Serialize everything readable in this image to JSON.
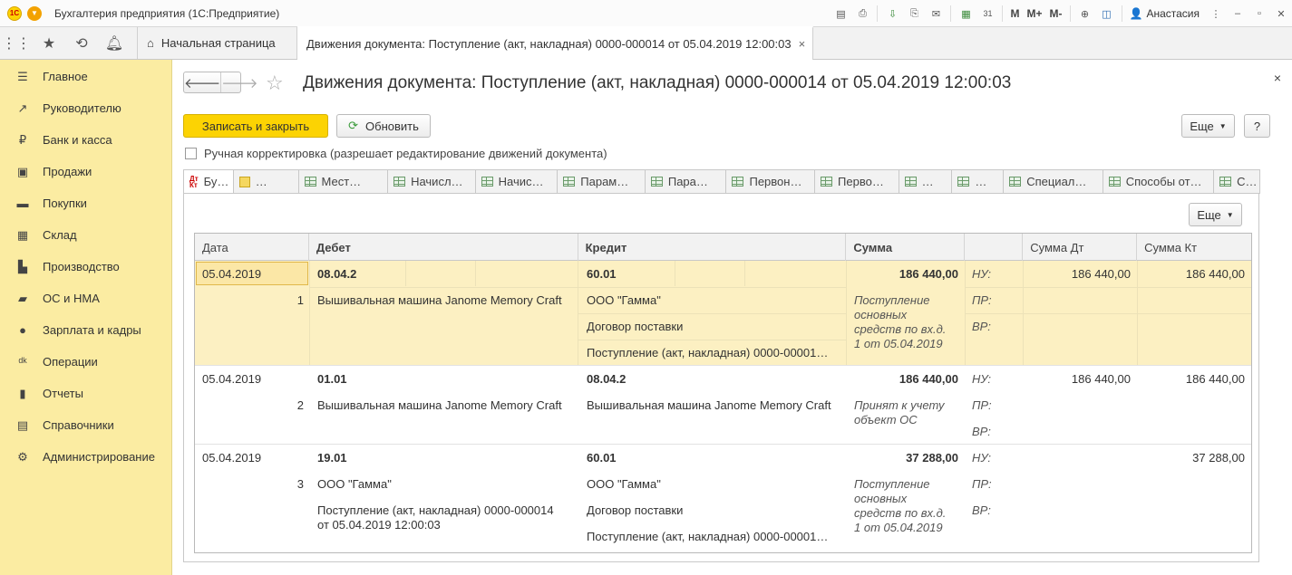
{
  "app": {
    "title": "Бухгалтерия предприятия  (1С:Предприятие)",
    "user": "Анастасия",
    "toolbar_m": [
      "M",
      "M+",
      "M-"
    ]
  },
  "tabs": {
    "home": "Начальная страница",
    "doc": "Движения документа: Поступление (акт, накладная) 0000-000014 от 05.04.2019 12:00:03",
    "close": "×"
  },
  "sidebar": {
    "items": [
      {
        "label": "Главное",
        "icon": "menu-icon"
      },
      {
        "label": "Руководителю",
        "icon": "trend-icon"
      },
      {
        "label": "Банк и касса",
        "icon": "ruble-icon"
      },
      {
        "label": "Продажи",
        "icon": "bag-icon"
      },
      {
        "label": "Покупки",
        "icon": "cart-icon"
      },
      {
        "label": "Склад",
        "icon": "warehouse-icon"
      },
      {
        "label": "Производство",
        "icon": "factory-icon"
      },
      {
        "label": "ОС и НМА",
        "icon": "truck-icon"
      },
      {
        "label": "Зарплата и кадры",
        "icon": "person-icon"
      },
      {
        "label": "Операции",
        "icon": "dtkt-icon"
      },
      {
        "label": "Отчеты",
        "icon": "chart-icon"
      },
      {
        "label": "Справочники",
        "icon": "books-icon"
      },
      {
        "label": "Администрирование",
        "icon": "gear-icon"
      }
    ]
  },
  "form": {
    "title": "Движения документа: Поступление (акт, накладная) 0000-000014 от 05.04.2019 12:00:03",
    "save_close": "Записать и закрыть",
    "refresh": "Обновить",
    "more": "Еще",
    "help": "?",
    "manual_correction": "Ручная корректировка (разрешает редактирование движений документа)",
    "close": "×"
  },
  "register_tabs": [
    {
      "label": "Бу…",
      "icon": "dtkt"
    },
    {
      "label": "…",
      "icon": "note"
    },
    {
      "label": "Мест…",
      "icon": "grid"
    },
    {
      "label": "Начисл…",
      "icon": "grid"
    },
    {
      "label": "Начис…",
      "icon": "grid"
    },
    {
      "label": "Парам…",
      "icon": "grid"
    },
    {
      "label": "Пара…",
      "icon": "grid"
    },
    {
      "label": "Первон…",
      "icon": "grid"
    },
    {
      "label": "Перво…",
      "icon": "grid"
    },
    {
      "label": "…",
      "icon": "grid"
    },
    {
      "label": "…",
      "icon": "grid"
    },
    {
      "label": "Специал…",
      "icon": "grid"
    },
    {
      "label": "Способы от…",
      "icon": "grid"
    },
    {
      "label": "С…",
      "icon": "grid"
    }
  ],
  "table": {
    "more": "Еще",
    "headers": {
      "date": "Дата",
      "debit": "Дебет",
      "credit": "Кредит",
      "sum": "Сумма",
      "blank": "",
      "sum_dt": "Сумма Дт",
      "sum_kt": "Сумма Кт"
    },
    "rows": [
      {
        "date": "05.04.2019",
        "n": "1",
        "debit": "08.04.2",
        "debit_sub": [
          "Вышивальная машина Janome Memory Craft"
        ],
        "credit": "60.01",
        "credit_sub": [
          "ООО \"Гамма\"",
          "Договор поставки",
          "Поступление (акт, накладная) 0000-00001…"
        ],
        "sum": "186 440,00",
        "content": "Поступление основных средств по вх.д. 1 от 05.04.2019",
        "content_lines": [
          "Поступление",
          "основных",
          "средств по вх.д.",
          "1 от 05.04.2019"
        ],
        "labels": [
          "НУ:",
          "ПР:",
          "ВР:"
        ],
        "sum_dt": "186 440,00",
        "sum_kt": "186 440,00"
      },
      {
        "date": "05.04.2019",
        "n": "2",
        "debit": "01.01",
        "debit_sub": [
          "Вышивальная машина Janome Memory Craft"
        ],
        "credit": "08.04.2",
        "credit_sub": [
          "Вышивальная машина Janome Memory Craft"
        ],
        "sum": "186 440,00",
        "content_lines": [
          "Принят к учету",
          "объект ОС"
        ],
        "labels": [
          "НУ:",
          "ПР:",
          "ВР:"
        ],
        "sum_dt": "186 440,00",
        "sum_kt": "186 440,00"
      },
      {
        "date": "05.04.2019",
        "n": "3",
        "debit": "19.01",
        "debit_sub": [
          "ООО \"Гамма\"",
          "Поступление (акт, накладная) 0000-000014",
          "от 05.04.2019 12:00:03"
        ],
        "credit": "60.01",
        "credit_sub": [
          "ООО \"Гамма\"",
          "Договор поставки",
          "Поступление (акт, накладная) 0000-00001…"
        ],
        "sum": "37 288,00",
        "content_lines": [
          "Поступление",
          "основных",
          "средств по вх.д.",
          "1 от 05.04.2019"
        ],
        "labels": [
          "НУ:",
          "ПР:",
          "ВР:"
        ],
        "sum_dt": "",
        "sum_kt": "37 288,00"
      }
    ]
  }
}
